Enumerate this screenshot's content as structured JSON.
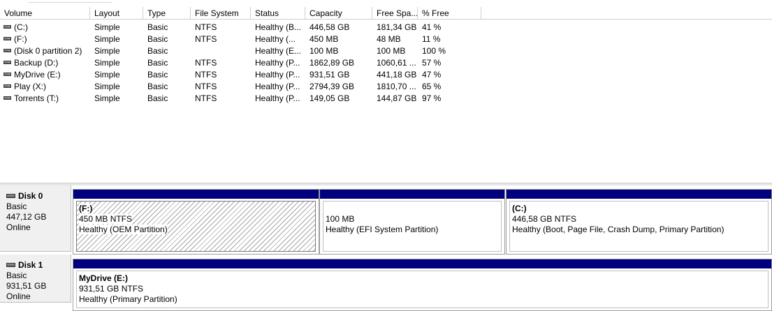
{
  "columns": [
    "Volume",
    "Layout",
    "Type",
    "File System",
    "Status",
    "Capacity",
    "Free Spa...",
    "% Free"
  ],
  "volumes": [
    {
      "volume": "(C:)",
      "layout": "Simple",
      "type": "Basic",
      "fs": "NTFS",
      "status": "Healthy (B...",
      "capacity": "446,58 GB",
      "free": "181,34 GB",
      "pct": "41 %"
    },
    {
      "volume": "(F:)",
      "layout": "Simple",
      "type": "Basic",
      "fs": "NTFS",
      "status": "Healthy (...",
      "capacity": "450 MB",
      "free": "48 MB",
      "pct": "11 %"
    },
    {
      "volume": "(Disk 0 partition 2)",
      "layout": "Simple",
      "type": "Basic",
      "fs": "",
      "status": "Healthy (E...",
      "capacity": "100 MB",
      "free": "100 MB",
      "pct": "100 %"
    },
    {
      "volume": "Backup (D:)",
      "layout": "Simple",
      "type": "Basic",
      "fs": "NTFS",
      "status": "Healthy (P...",
      "capacity": "1862,89 GB",
      "free": "1060,61 ...",
      "pct": "57 %"
    },
    {
      "volume": "MyDrive (E:)",
      "layout": "Simple",
      "type": "Basic",
      "fs": "NTFS",
      "status": "Healthy (P...",
      "capacity": "931,51 GB",
      "free": "441,18 GB",
      "pct": "47 %"
    },
    {
      "volume": "Play (X:)",
      "layout": "Simple",
      "type": "Basic",
      "fs": "NTFS",
      "status": "Healthy (P...",
      "capacity": "2794,39 GB",
      "free": "1810,70 ...",
      "pct": "65 %"
    },
    {
      "volume": "Torrents (T:)",
      "layout": "Simple",
      "type": "Basic",
      "fs": "NTFS",
      "status": "Healthy (P...",
      "capacity": "149,05 GB",
      "free": "144,87 GB",
      "pct": "97 %"
    }
  ],
  "disks": [
    {
      "name": "Disk 0",
      "type": "Basic",
      "size": "447,12 GB",
      "state": "Online",
      "partitions": [
        {
          "title": "(F:)",
          "size": "450 MB NTFS",
          "status": "Healthy (OEM Partition)",
          "hatched": true
        },
        {
          "title": "",
          "size": "100 MB",
          "status": "Healthy (EFI System Partition)",
          "hatched": false
        },
        {
          "title": "(C:)",
          "size": "446,58 GB NTFS",
          "status": "Healthy (Boot, Page File, Crash Dump, Primary Partition)",
          "hatched": false
        }
      ]
    },
    {
      "name": "Disk 1",
      "type": "Basic",
      "size": "931,51 GB",
      "state": "Online",
      "partitions": [
        {
          "title": "MyDrive  (E:)",
          "size": "931,51 GB NTFS",
          "status": "Healthy (Primary Partition)",
          "hatched": false
        }
      ]
    }
  ],
  "colors": {
    "partition_bar": "#00007e",
    "disk_label_bg": "#f0f0f0",
    "hatch": "#a6a6a6"
  },
  "icons": {
    "volume": "drive-icon",
    "disk": "disk-icon"
  }
}
